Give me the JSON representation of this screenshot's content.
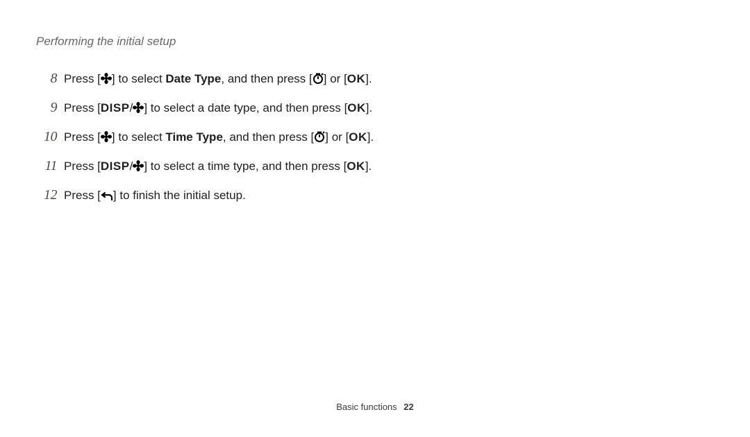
{
  "sectionTitle": "Performing the initial setup",
  "steps": [
    {
      "num": "8",
      "parts": [
        {
          "t": "text",
          "v": "Press ["
        },
        {
          "t": "icon",
          "v": "macro"
        },
        {
          "t": "text",
          "v": "] to select "
        },
        {
          "t": "bold",
          "v": "Date Type"
        },
        {
          "t": "text",
          "v": ", and then press ["
        },
        {
          "t": "icon",
          "v": "timer"
        },
        {
          "t": "text",
          "v": "] or ["
        },
        {
          "t": "ok",
          "v": "OK"
        },
        {
          "t": "text",
          "v": "]."
        }
      ]
    },
    {
      "num": "9",
      "parts": [
        {
          "t": "text",
          "v": "Press ["
        },
        {
          "t": "disp",
          "v": "DISP"
        },
        {
          "t": "text",
          "v": "/"
        },
        {
          "t": "icon",
          "v": "macro"
        },
        {
          "t": "text",
          "v": "] to select a date type, and then press ["
        },
        {
          "t": "ok",
          "v": "OK"
        },
        {
          "t": "text",
          "v": "]."
        }
      ]
    },
    {
      "num": "10",
      "parts": [
        {
          "t": "text",
          "v": "Press ["
        },
        {
          "t": "icon",
          "v": "macro"
        },
        {
          "t": "text",
          "v": "] to select "
        },
        {
          "t": "bold",
          "v": "Time Type"
        },
        {
          "t": "text",
          "v": ", and then press ["
        },
        {
          "t": "icon",
          "v": "timer"
        },
        {
          "t": "text",
          "v": "] or ["
        },
        {
          "t": "ok",
          "v": "OK"
        },
        {
          "t": "text",
          "v": "]."
        }
      ]
    },
    {
      "num": "11",
      "parts": [
        {
          "t": "text",
          "v": "Press ["
        },
        {
          "t": "disp",
          "v": "DISP"
        },
        {
          "t": "text",
          "v": "/"
        },
        {
          "t": "icon",
          "v": "macro"
        },
        {
          "t": "text",
          "v": "] to select a time type, and then press ["
        },
        {
          "t": "ok",
          "v": "OK"
        },
        {
          "t": "text",
          "v": "]."
        }
      ]
    },
    {
      "num": "12",
      "parts": [
        {
          "t": "text",
          "v": "Press ["
        },
        {
          "t": "icon",
          "v": "back"
        },
        {
          "t": "text",
          "v": "] to finish the initial setup."
        }
      ]
    }
  ],
  "footer": {
    "section": "Basic functions",
    "page": "22"
  }
}
